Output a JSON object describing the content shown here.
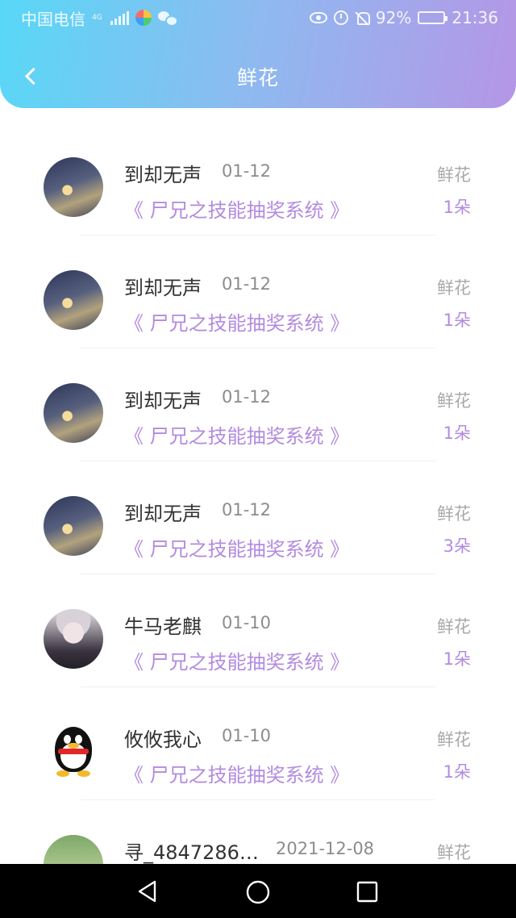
{
  "status_bar": {
    "carrier": "中国电信",
    "network": "4G",
    "battery": "92%",
    "time": "21:36",
    "battery_level": 0.92
  },
  "nav": {
    "title": "鲜花"
  },
  "items": [
    {
      "name": "到却无声",
      "date": "01-12",
      "book": "《 尸兄之技能抽奖系统 》",
      "gift_label": "鲜花",
      "count": "1朵",
      "avatar": "city-night-avatar"
    },
    {
      "name": "到却无声",
      "date": "01-12",
      "book": "《 尸兄之技能抽奖系统 》",
      "gift_label": "鲜花",
      "count": "1朵",
      "avatar": "city-night-avatar"
    },
    {
      "name": "到却无声",
      "date": "01-12",
      "book": "《 尸兄之技能抽奖系统 》",
      "gift_label": "鲜花",
      "count": "1朵",
      "avatar": "city-night-avatar"
    },
    {
      "name": "到却无声",
      "date": "01-12",
      "book": "《 尸兄之技能抽奖系统 》",
      "gift_label": "鲜花",
      "count": "3朵",
      "avatar": "city-night-avatar"
    },
    {
      "name": "牛马老麒",
      "date": "01-10",
      "book": "《 尸兄之技能抽奖系统 》",
      "gift_label": "鲜花",
      "count": "1朵",
      "avatar": "anime-avatar"
    },
    {
      "name": "攸攸我心",
      "date": "01-10",
      "book": "《 尸兄之技能抽奖系统 》",
      "gift_label": "鲜花",
      "count": "1朵",
      "avatar": "qq-penguin-avatar"
    },
    {
      "name": "寻_4847286…",
      "date": "2021-12-08",
      "gift_label": "鲜花",
      "avatar": "photo-avatar"
    }
  ]
}
